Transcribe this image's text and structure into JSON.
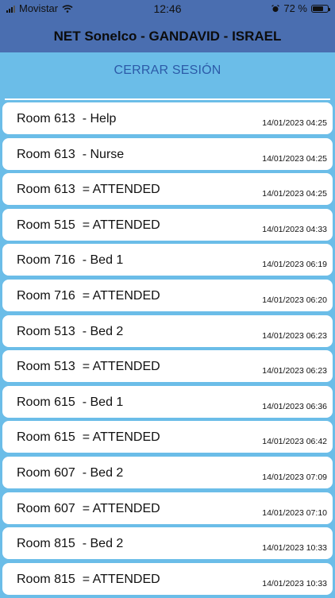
{
  "status_bar": {
    "carrier": "Movistar",
    "time": "12:46",
    "battery": "72 %",
    "battery_level": 0.72
  },
  "header": {
    "title": "NET Sonelco - GANDAVID - ISRAEL"
  },
  "logout_label": "CERRAR SESIÓN",
  "alerts": [
    {
      "room": "Room 613",
      "status": "  - Help",
      "time": "14/01/2023 04:25"
    },
    {
      "room": "Room 613",
      "status": "  - Nurse",
      "time": "14/01/2023 04:25"
    },
    {
      "room": "Room 613",
      "status": "  = ATTENDED",
      "time": "14/01/2023 04:25"
    },
    {
      "room": "Room 515",
      "status": "  = ATTENDED",
      "time": "14/01/2023 04:33"
    },
    {
      "room": "Room 716",
      "status": "  - Bed 1",
      "time": "14/01/2023 06:19"
    },
    {
      "room": "Room 716",
      "status": "  = ATTENDED",
      "time": "14/01/2023 06:20"
    },
    {
      "room": "Room 513",
      "status": "  - Bed 2",
      "time": "14/01/2023 06:23"
    },
    {
      "room": "Room 513",
      "status": "  = ATTENDED",
      "time": "14/01/2023 06:23"
    },
    {
      "room": "Room 615",
      "status": "  - Bed 1",
      "time": "14/01/2023 06:36"
    },
    {
      "room": "Room 615",
      "status": "  = ATTENDED",
      "time": "14/01/2023 06:42"
    },
    {
      "room": "Room 607",
      "status": "  - Bed 2",
      "time": "14/01/2023 07:09"
    },
    {
      "room": "Room 607",
      "status": "  = ATTENDED",
      "time": "14/01/2023 07:10"
    },
    {
      "room": "Room 815",
      "status": "  - Bed 2",
      "time": "14/01/2023 10:33"
    },
    {
      "room": "Room 815",
      "status": "  = ATTENDED",
      "time": "14/01/2023 10:33"
    }
  ]
}
